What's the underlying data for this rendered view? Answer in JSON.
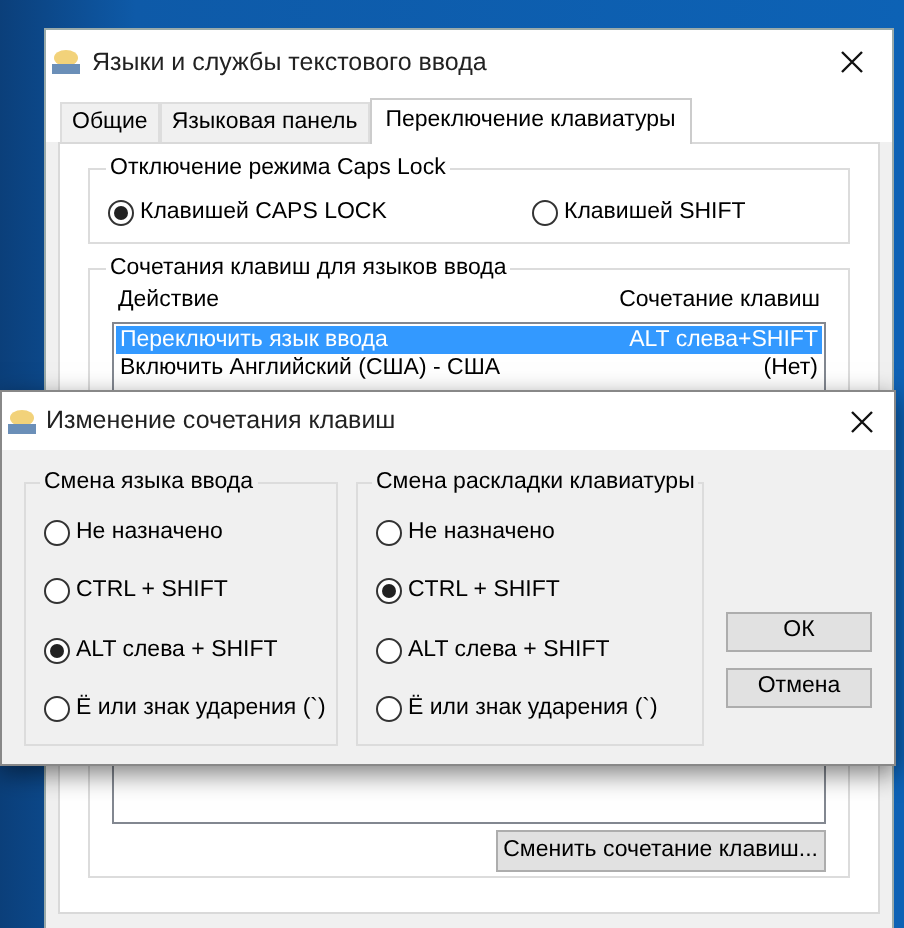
{
  "main_window": {
    "title": "Языки и службы текстового ввода",
    "tabs": [
      {
        "label": "Общие",
        "selected": false
      },
      {
        "label": "Языковая панель",
        "selected": false
      },
      {
        "label": "Переключение клавиатуры",
        "selected": true
      }
    ],
    "caps_lock_group": {
      "title": "Отключение режима Caps Lock",
      "options": [
        {
          "label": "Клавишей CAPS LOCK",
          "selected": true
        },
        {
          "label": "Клавишей SHIFT",
          "selected": false
        }
      ]
    },
    "hotkeys_group": {
      "title": "Сочетания клавиш для языков ввода",
      "columns": [
        "Действие",
        "Сочетание клавиш"
      ],
      "rows": [
        {
          "action": "Переключить язык ввода",
          "keys": "ALT слева+SHIFT",
          "selected": true
        },
        {
          "action": "Включить Английский (США) - США",
          "keys": "(Нет)",
          "selected": false
        }
      ],
      "change_button": "Сменить сочетание клавиш..."
    }
  },
  "dialog": {
    "title": "Изменение сочетания клавиш",
    "groups": [
      {
        "title": "Смена языка ввода",
        "options": [
          {
            "label": "Не назначено",
            "selected": false
          },
          {
            "label": "CTRL + SHIFT",
            "selected": false
          },
          {
            "label": "ALT слева + SHIFT",
            "selected": true
          },
          {
            "label": "Ё или знак ударения (`)",
            "selected": false
          }
        ]
      },
      {
        "title": "Смена раскладки клавиатуры",
        "options": [
          {
            "label": "Не назначено",
            "selected": false
          },
          {
            "label": "CTRL + SHIFT",
            "selected": true
          },
          {
            "label": "ALT слева + SHIFT",
            "selected": false
          },
          {
            "label": "Ё или знак ударения (`)",
            "selected": false
          }
        ]
      }
    ],
    "buttons": [
      "ОК",
      "Отмена"
    ]
  }
}
